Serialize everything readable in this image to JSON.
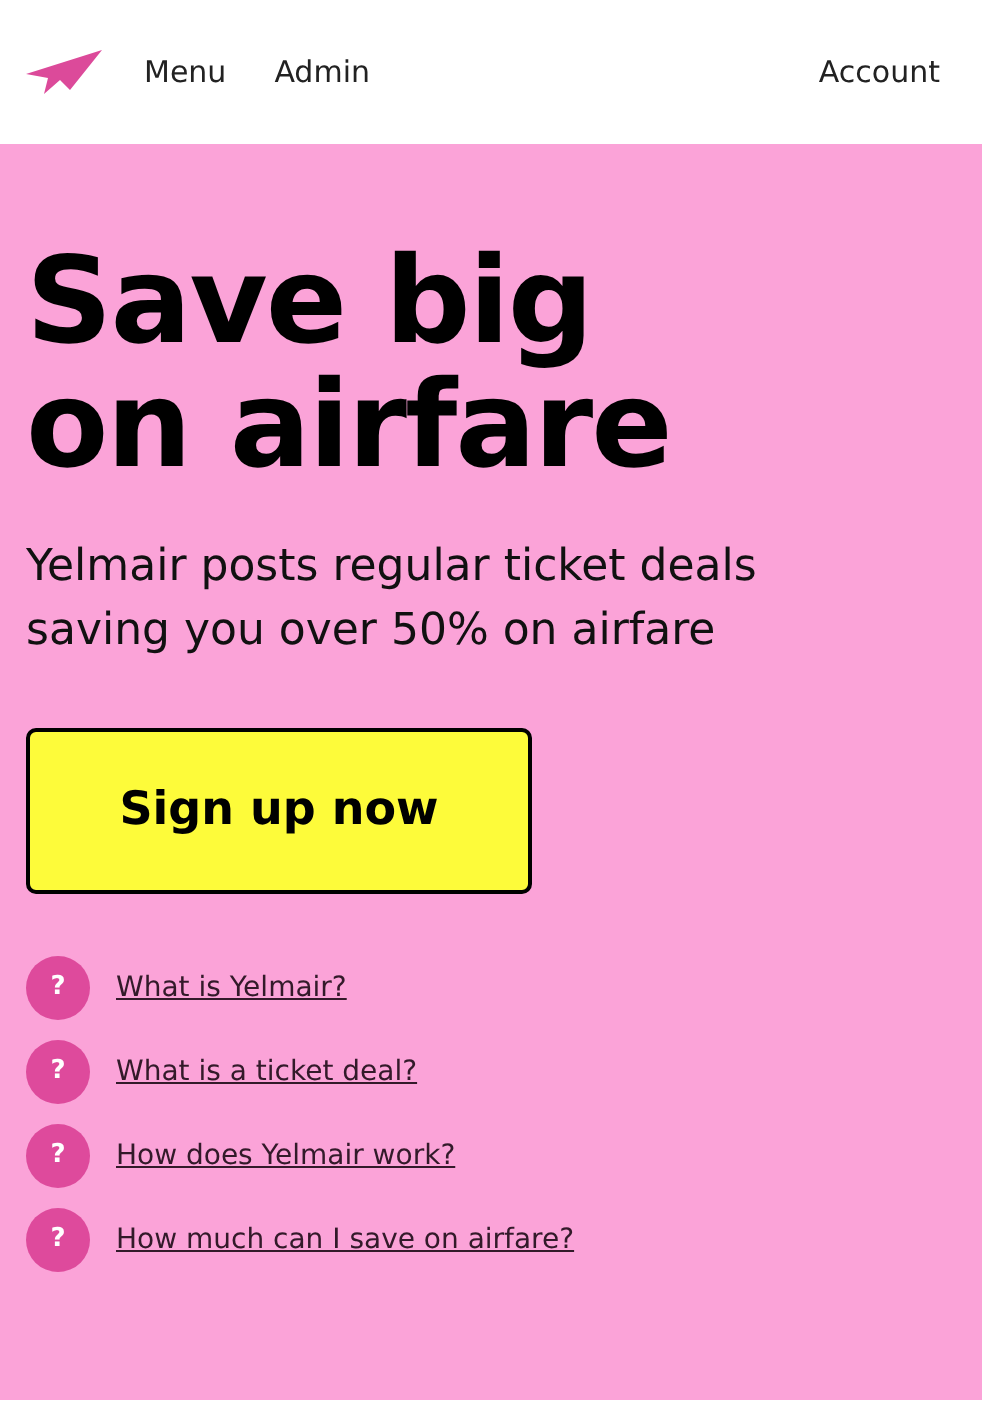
{
  "header": {
    "nav": [
      {
        "label": "Menu"
      },
      {
        "label": "Admin"
      }
    ],
    "account": "Account"
  },
  "hero": {
    "title_lines": [
      "Save big",
      "on airfare"
    ],
    "subtitle": "Yelmair posts regular ticket deals saving you over 50% on airfare",
    "cta": "Sign up now"
  },
  "faq": [
    {
      "icon": "?",
      "question": "What is Yelmair?"
    },
    {
      "icon": "?",
      "question": "What is a ticket deal?"
    },
    {
      "icon": "?",
      "question": "How does Yelmair work?"
    },
    {
      "icon": "?",
      "question": "How much can I save on airfare?"
    }
  ]
}
